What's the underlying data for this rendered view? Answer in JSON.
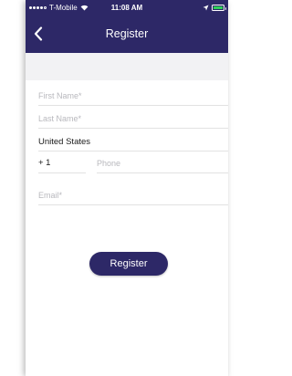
{
  "status_bar": {
    "carrier": "T-Mobile",
    "time": "11:08 AM",
    "battery_color": "#2fd158"
  },
  "nav": {
    "title": "Register",
    "back_icon": "chevron-left-icon"
  },
  "form": {
    "first_name": {
      "placeholder": "First Name*",
      "value": ""
    },
    "last_name": {
      "placeholder": "Last Name*",
      "value": ""
    },
    "country": {
      "value": "United States"
    },
    "dial_code": {
      "value": "+ 1"
    },
    "phone": {
      "placeholder": "Phone",
      "value": ""
    },
    "email": {
      "placeholder": "Email*",
      "value": ""
    },
    "submit_label": "Register"
  },
  "theme": {
    "primary": "#2d2867",
    "background": "#ffffff",
    "band": "#f2f2f4",
    "divider": "#e2e2e2",
    "placeholder_text": "#b8b8bd"
  }
}
